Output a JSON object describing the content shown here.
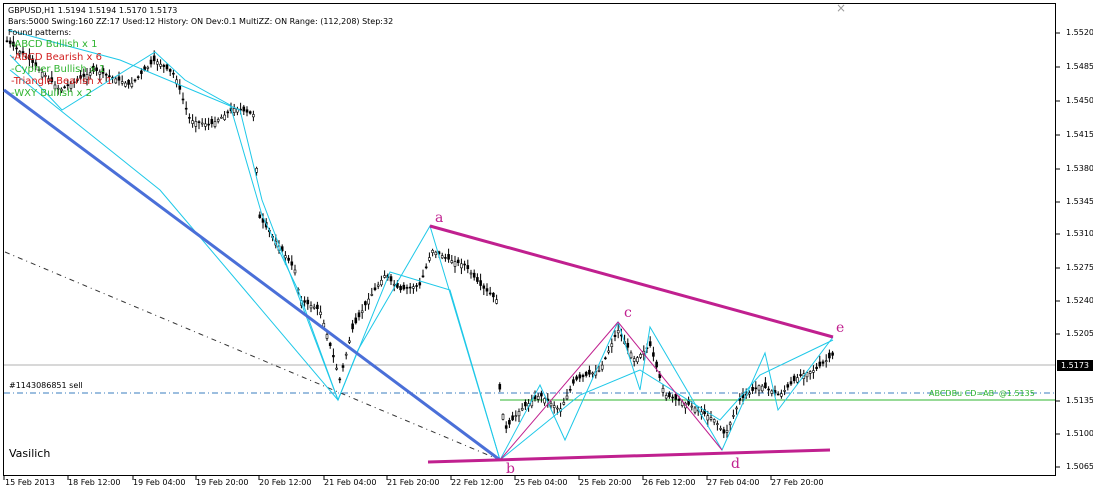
{
  "header": {
    "line1": "GBPUSD,H1  1.5194 1.5194 1.5170 1.5173",
    "line2": "Bars:5000  Swing:160  ZZ:17  Used:12  History: ON Dev:0.1  MultiZZ: ON  Range: (112,208)  Step:32",
    "line3": "Found patterns:"
  },
  "patterns": [
    {
      "text": "-ABCD Bullish x 1",
      "color": "#2fb42f"
    },
    {
      "text": "-ABCD Bearish x 6",
      "color": "#d21e1e"
    },
    {
      "text": "-Cypher Bullish x 1",
      "color": "#2fb42f"
    },
    {
      "text": "-Triangle Bearish x 1",
      "color": "#d21e1e"
    },
    {
      "text": "-WXY Bullish x 2",
      "color": "#2fb42f"
    }
  ],
  "price_axis": [
    "1.5520",
    "1.5485",
    "1.5450",
    "1.5415",
    "1.5380",
    "1.5345",
    "1.5310",
    "1.5275",
    "1.5240",
    "1.5205",
    "1.5135",
    "1.5100",
    "1.5065"
  ],
  "current_price": "1.5173",
  "time_axis": [
    "15 Feb 2013",
    "18 Feb 12:00",
    "19 Feb 04:00",
    "19 Feb 20:00",
    "20 Feb 12:00",
    "21 Feb 04:00",
    "21 Feb 20:00",
    "22 Feb 12:00",
    "25 Feb 04:00",
    "25 Feb 20:00",
    "26 Feb 12:00",
    "27 Feb 04:00",
    "27 Feb 20:00"
  ],
  "points": {
    "a": "a",
    "b": "b",
    "c": "c",
    "d": "d",
    "e": "e"
  },
  "order_label": "#1143086851 sell",
  "abcd_label": "ABCDBu CD=AB' @1.5135",
  "signature": "Vasilich",
  "colors": {
    "triangle": "#c0208f",
    "zigzag": "#1ec8e8",
    "trend": "#4a6fd8",
    "level": "#2fb42f"
  }
}
